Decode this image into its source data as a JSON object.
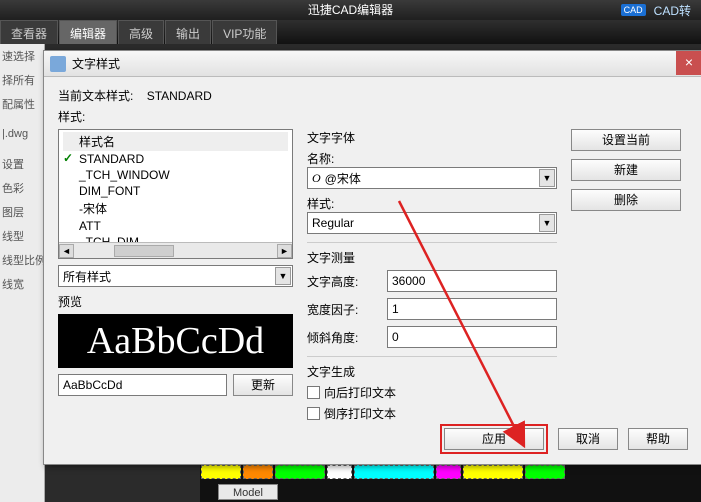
{
  "app": {
    "title": "迅捷CAD编辑器",
    "badge_cad": "CAD",
    "badge_text": "CAD转"
  },
  "ribbon": {
    "tabs": [
      "查看器",
      "编辑器",
      "高级",
      "输出",
      "VIP功能"
    ],
    "active_index": 1
  },
  "sidebar": {
    "items": [
      "速选择",
      "择所有",
      "配属性",
      "",
      "|.dwg",
      "",
      "设置",
      "色彩",
      "图层",
      "线型",
      "线型比例",
      "线宽",
      ""
    ]
  },
  "dialog": {
    "title": "文字样式",
    "current_label": "当前文本样式:",
    "current_value": "STANDARD",
    "styles_label": "样式:",
    "style_name_header": "样式名",
    "style_list": [
      "STANDARD",
      "_TCH_WINDOW",
      "DIM_FONT",
      "-宋体",
      "ATT",
      "_TCH_DIM"
    ],
    "checked_index": 0,
    "filter_value": "所有样式",
    "preview_label": "预览",
    "preview_big": "AaBbCcDd",
    "preview_input": "AaBbCcDd",
    "update_btn": "更新",
    "font_group": "文字字体",
    "font_name_label": "名称:",
    "font_name_value": "@宋体",
    "font_style_label": "样式:",
    "font_style_value": "Regular",
    "measure_group": "文字测量",
    "height_label": "文字高度:",
    "height_value": "36000",
    "width_label": "宽度因子:",
    "width_value": "1",
    "oblique_label": "倾斜角度:",
    "oblique_value": "0",
    "gen_group": "文字生成",
    "gen_back": "向后打印文本",
    "gen_upside": "倒序打印文本",
    "btn_set_current": "设置当前",
    "btn_new": "新建",
    "btn_delete": "删除",
    "btn_apply": "应用",
    "btn_cancel": "取消",
    "btn_help": "帮助"
  },
  "modelspace": {
    "tab": "Model"
  }
}
